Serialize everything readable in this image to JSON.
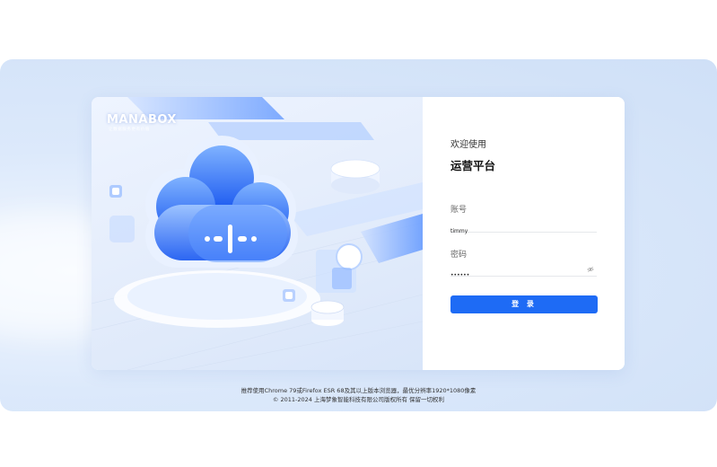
{
  "brand": {
    "logo": "MANABOX",
    "tagline": "让数据服务更有价值"
  },
  "login": {
    "welcome": "欢迎使用",
    "platform": "运营平台",
    "account_label": "账号",
    "account_value": "timmy",
    "password_label": "密码",
    "password_value": "••••••",
    "submit_label": "登 录",
    "eye_icon": "eye-off-icon"
  },
  "footer": {
    "browser_note": "推荐使用Chrome 79或Firefox ESR 68及其以上版本浏览器，最优分辨率1920*1080像素",
    "copyright": "© 2011-2024 上海梦象智能科技有限公司版权所有 保留一切权利"
  },
  "colors": {
    "primary": "#1e6bf5",
    "background": "#dce9fb"
  }
}
